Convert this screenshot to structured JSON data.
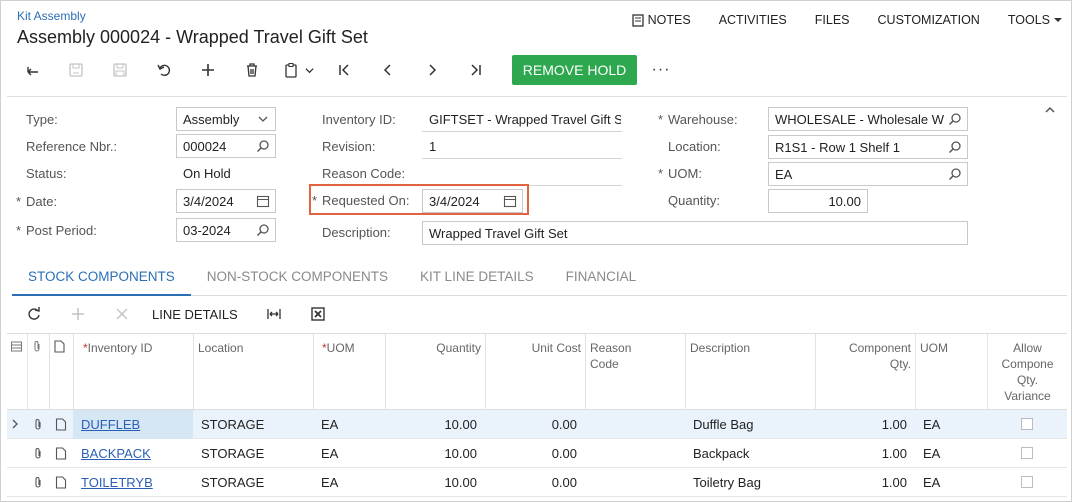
{
  "header": {
    "breadcrumb": "Kit Assembly",
    "title": "Assembly 000024 - Wrapped Travel Gift Set",
    "nav": {
      "notes": "NOTES",
      "activities": "ACTIVITIES",
      "files": "FILES",
      "customization": "CUSTOMIZATION",
      "tools": "TOOLS"
    }
  },
  "toolbar": {
    "remove_hold": "REMOVE HOLD",
    "more": "···"
  },
  "form": {
    "type_label": "Type:",
    "type_value": "Assembly",
    "refnbr_label": "Reference Nbr.:",
    "refnbr_value": "000024",
    "status_label": "Status:",
    "status_value": "On Hold",
    "date_label": "Date:",
    "date_value": "3/4/2024",
    "postperiod_label": "Post Period:",
    "postperiod_value": "03-2024",
    "inventory_label": "Inventory ID:",
    "inventory_value": "GIFTSET - Wrapped Travel Gift S",
    "revision_label": "Revision:",
    "revision_value": "1",
    "reason_label": "Reason Code:",
    "reason_value": "",
    "requested_label": "Requested On:",
    "requested_value": "3/4/2024",
    "description_label": "Description:",
    "description_value": "Wrapped Travel Gift Set",
    "warehouse_label": "Warehouse:",
    "warehouse_value": "WHOLESALE - Wholesale W",
    "location_label": "Location:",
    "location_value": "R1S1 - Row 1 Shelf 1",
    "uom_label": "UOM:",
    "uom_value": "EA",
    "quantity_label": "Quantity:",
    "quantity_value": "10.00"
  },
  "tabs": [
    "STOCK COMPONENTS",
    "NON-STOCK COMPONENTS",
    "KIT LINE DETAILS",
    "FINANCIAL"
  ],
  "grid_toolbar": {
    "line_details": "LINE DETAILS"
  },
  "grid": {
    "columns": {
      "inventory_id": "Inventory ID",
      "location": "Location",
      "uom": "UOM",
      "quantity": "Quantity",
      "unit_cost": "Unit Cost",
      "reason_code": "Reason Code",
      "description": "Description",
      "component_qty": "Component Qty.",
      "uom2": "UOM",
      "allow_variance": "Allow Compone Qty. Variance"
    },
    "rows": [
      {
        "inventory_id": "DUFFLEB",
        "location": "STORAGE",
        "uom": "EA",
        "quantity": "10.00",
        "unit_cost": "0.00",
        "reason_code": "",
        "description": "Duffle Bag",
        "component_qty": "1.00",
        "uom2": "EA"
      },
      {
        "inventory_id": "BACKPACK",
        "location": "STORAGE",
        "uom": "EA",
        "quantity": "10.00",
        "unit_cost": "0.00",
        "reason_code": "",
        "description": "Backpack",
        "component_qty": "1.00",
        "uom2": "EA"
      },
      {
        "inventory_id": "TOILETRYB",
        "location": "STORAGE",
        "uom": "EA",
        "quantity": "10.00",
        "unit_cost": "0.00",
        "reason_code": "",
        "description": "Toiletry Bag",
        "component_qty": "1.00",
        "uom2": "EA"
      }
    ]
  },
  "colors": {
    "accent": "#2b6fb5",
    "primary_button": "#2ea84f",
    "highlight_outline": "#e2633f"
  }
}
